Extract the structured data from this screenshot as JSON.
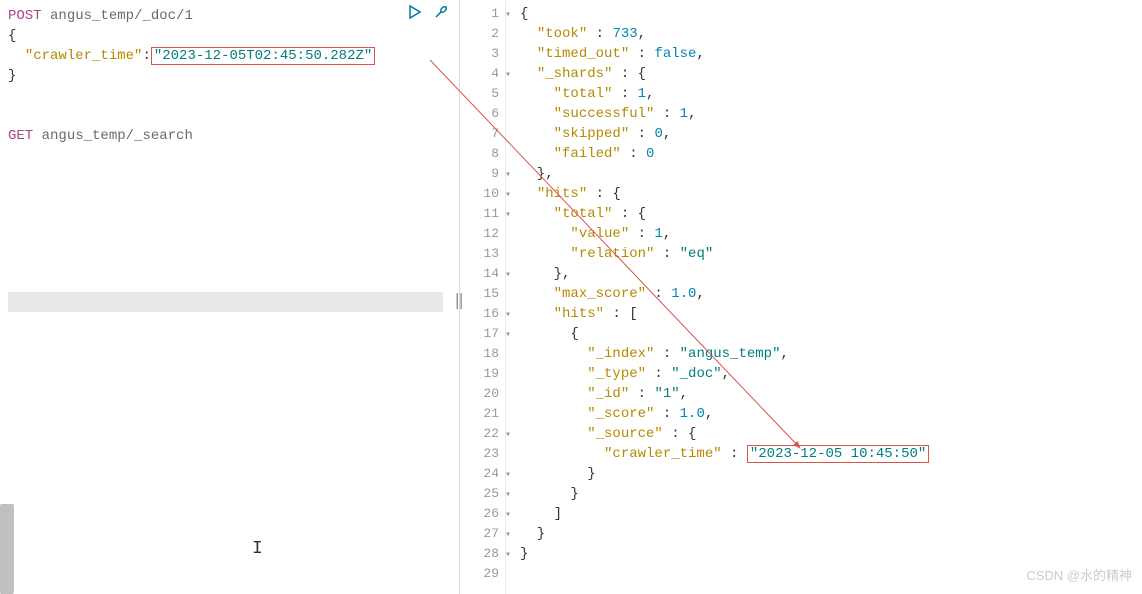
{
  "left": {
    "request1": {
      "method": "POST",
      "path": "angus_temp/_doc/1",
      "body_open": "{",
      "field_key": "\"crawler_time\"",
      "field_sep": ":",
      "field_val": "\"2023-12-05T02:45:50.282Z\"",
      "body_close": "}"
    },
    "request2": {
      "method": "GET",
      "path": "angus_temp/_search"
    },
    "run_icon": "play-icon",
    "wrench_icon": "wrench-icon"
  },
  "right": {
    "lines": [
      {
        "n": "1",
        "fold": true,
        "txt": [
          {
            "t": "{",
            "c": "opunct"
          }
        ]
      },
      {
        "n": "2",
        "txt": [
          {
            "t": "  ",
            "c": ""
          },
          {
            "t": "\"took\"",
            "c": "okey"
          },
          {
            "t": " : ",
            "c": "opunct"
          },
          {
            "t": "733",
            "c": "onum"
          },
          {
            "t": ",",
            "c": "opunct"
          }
        ]
      },
      {
        "n": "3",
        "txt": [
          {
            "t": "  ",
            "c": ""
          },
          {
            "t": "\"timed_out\"",
            "c": "okey"
          },
          {
            "t": " : ",
            "c": "opunct"
          },
          {
            "t": "false",
            "c": "obool"
          },
          {
            "t": ",",
            "c": "opunct"
          }
        ]
      },
      {
        "n": "4",
        "fold": true,
        "txt": [
          {
            "t": "  ",
            "c": ""
          },
          {
            "t": "\"_shards\"",
            "c": "okey"
          },
          {
            "t": " : {",
            "c": "opunct"
          }
        ]
      },
      {
        "n": "5",
        "txt": [
          {
            "t": "    ",
            "c": ""
          },
          {
            "t": "\"total\"",
            "c": "okey"
          },
          {
            "t": " : ",
            "c": "opunct"
          },
          {
            "t": "1",
            "c": "onum"
          },
          {
            "t": ",",
            "c": "opunct"
          }
        ]
      },
      {
        "n": "6",
        "txt": [
          {
            "t": "    ",
            "c": ""
          },
          {
            "t": "\"successful\"",
            "c": "okey"
          },
          {
            "t": " : ",
            "c": "opunct"
          },
          {
            "t": "1",
            "c": "onum"
          },
          {
            "t": ",",
            "c": "opunct"
          }
        ]
      },
      {
        "n": "7",
        "txt": [
          {
            "t": "    ",
            "c": ""
          },
          {
            "t": "\"skipped\"",
            "c": "okey"
          },
          {
            "t": " : ",
            "c": "opunct"
          },
          {
            "t": "0",
            "c": "onum"
          },
          {
            "t": ",",
            "c": "opunct"
          }
        ]
      },
      {
        "n": "8",
        "txt": [
          {
            "t": "    ",
            "c": ""
          },
          {
            "t": "\"failed\"",
            "c": "okey"
          },
          {
            "t": " : ",
            "c": "opunct"
          },
          {
            "t": "0",
            "c": "onum"
          }
        ]
      },
      {
        "n": "9",
        "fold": true,
        "txt": [
          {
            "t": "  },",
            "c": "opunct"
          }
        ]
      },
      {
        "n": "10",
        "fold": true,
        "txt": [
          {
            "t": "  ",
            "c": ""
          },
          {
            "t": "\"hits\"",
            "c": "okey"
          },
          {
            "t": " : {",
            "c": "opunct"
          }
        ]
      },
      {
        "n": "11",
        "fold": true,
        "txt": [
          {
            "t": "    ",
            "c": ""
          },
          {
            "t": "\"total\"",
            "c": "okey"
          },
          {
            "t": " : {",
            "c": "opunct"
          }
        ]
      },
      {
        "n": "12",
        "txt": [
          {
            "t": "      ",
            "c": ""
          },
          {
            "t": "\"value\"",
            "c": "okey"
          },
          {
            "t": " : ",
            "c": "opunct"
          },
          {
            "t": "1",
            "c": "onum"
          },
          {
            "t": ",",
            "c": "opunct"
          }
        ]
      },
      {
        "n": "13",
        "txt": [
          {
            "t": "      ",
            "c": ""
          },
          {
            "t": "\"relation\"",
            "c": "okey"
          },
          {
            "t": " : ",
            "c": "opunct"
          },
          {
            "t": "\"eq\"",
            "c": "ostr"
          }
        ]
      },
      {
        "n": "14",
        "fold": true,
        "txt": [
          {
            "t": "    },",
            "c": "opunct"
          }
        ]
      },
      {
        "n": "15",
        "txt": [
          {
            "t": "    ",
            "c": ""
          },
          {
            "t": "\"max_score\"",
            "c": "okey"
          },
          {
            "t": " : ",
            "c": "opunct"
          },
          {
            "t": "1.0",
            "c": "onum"
          },
          {
            "t": ",",
            "c": "opunct"
          }
        ]
      },
      {
        "n": "16",
        "fold": true,
        "txt": [
          {
            "t": "    ",
            "c": ""
          },
          {
            "t": "\"hits\"",
            "c": "okey"
          },
          {
            "t": " : [",
            "c": "opunct"
          }
        ]
      },
      {
        "n": "17",
        "fold": true,
        "txt": [
          {
            "t": "      {",
            "c": "opunct"
          }
        ]
      },
      {
        "n": "18",
        "txt": [
          {
            "t": "        ",
            "c": ""
          },
          {
            "t": "\"_index\"",
            "c": "okey"
          },
          {
            "t": " : ",
            "c": "opunct"
          },
          {
            "t": "\"angus_temp\"",
            "c": "ostr"
          },
          {
            "t": ",",
            "c": "opunct"
          }
        ]
      },
      {
        "n": "19",
        "txt": [
          {
            "t": "        ",
            "c": ""
          },
          {
            "t": "\"_type\"",
            "c": "okey"
          },
          {
            "t": " : ",
            "c": "opunct"
          },
          {
            "t": "\"_doc\"",
            "c": "ostr"
          },
          {
            "t": ",",
            "c": "opunct"
          }
        ]
      },
      {
        "n": "20",
        "txt": [
          {
            "t": "        ",
            "c": ""
          },
          {
            "t": "\"_id\"",
            "c": "okey"
          },
          {
            "t": " : ",
            "c": "opunct"
          },
          {
            "t": "\"1\"",
            "c": "ostr"
          },
          {
            "t": ",",
            "c": "opunct"
          }
        ]
      },
      {
        "n": "21",
        "txt": [
          {
            "t": "        ",
            "c": ""
          },
          {
            "t": "\"_score\"",
            "c": "okey"
          },
          {
            "t": " : ",
            "c": "opunct"
          },
          {
            "t": "1.0",
            "c": "onum"
          },
          {
            "t": ",",
            "c": "opunct"
          }
        ]
      },
      {
        "n": "22",
        "fold": true,
        "txt": [
          {
            "t": "        ",
            "c": ""
          },
          {
            "t": "\"_source\"",
            "c": "okey"
          },
          {
            "t": " : {",
            "c": "opunct"
          }
        ]
      },
      {
        "n": "23",
        "txt": [
          {
            "t": "          ",
            "c": ""
          },
          {
            "t": "\"crawler_time\"",
            "c": "okey"
          },
          {
            "t": " : ",
            "c": "opunct"
          },
          {
            "t": "\"2023-12-05 10:45:50\"",
            "c": "ostr",
            "box": true
          }
        ]
      },
      {
        "n": "24",
        "fold": true,
        "txt": [
          {
            "t": "        }",
            "c": "opunct"
          }
        ]
      },
      {
        "n": "25",
        "fold": true,
        "txt": [
          {
            "t": "      }",
            "c": "opunct"
          }
        ]
      },
      {
        "n": "26",
        "fold": true,
        "txt": [
          {
            "t": "    ]",
            "c": "opunct"
          }
        ]
      },
      {
        "n": "27",
        "fold": true,
        "txt": [
          {
            "t": "  }",
            "c": "opunct"
          }
        ]
      },
      {
        "n": "28",
        "fold": true,
        "txt": [
          {
            "t": "}",
            "c": "opunct"
          }
        ]
      },
      {
        "n": "29",
        "txt": []
      }
    ]
  },
  "watermark": "CSDN @水的精神"
}
